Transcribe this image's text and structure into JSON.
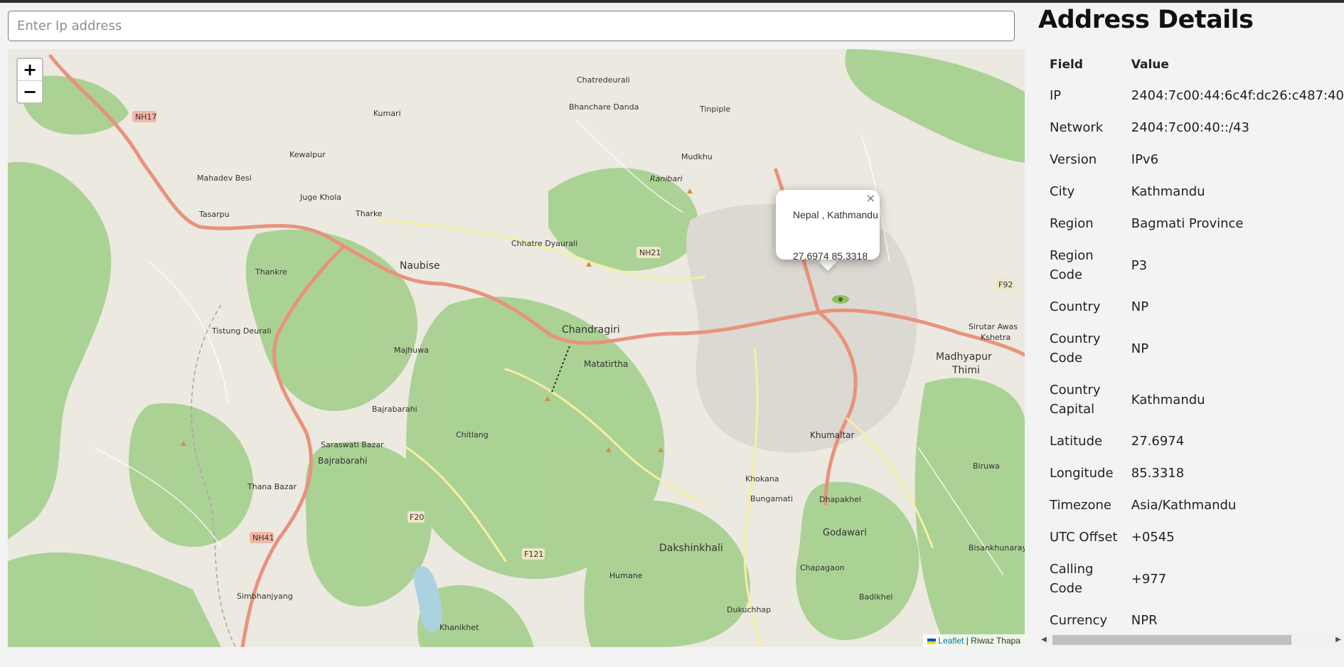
{
  "search": {
    "placeholder": "Enter Ip address"
  },
  "map": {
    "zoom_in": "+",
    "zoom_out": "−",
    "popup": {
      "location": "Nepal , Kathmandu",
      "coords": "27.6974 85.3318",
      "close": "×"
    },
    "attribution": {
      "leaflet": "Leaflet",
      "separator": " | ",
      "author": "Riwaz Thapa"
    },
    "labels": [
      "Chandragiri",
      "Naubise",
      "Dakshinkhali",
      "Khumaltar",
      "Godawari",
      "Matatirtha",
      "Kewalpur",
      "Kumari",
      "Tarke",
      "Thankre",
      "Majhuwa",
      "Chitlang",
      "Bajrabarahi",
      "Saraswati Bazar",
      "Thana Bazar",
      "Simbhanjyang",
      "Tistung Deurali",
      "Mahadev Besi",
      "Juge Khola",
      "Tasarpu",
      "Chhatre Dyaurali",
      "Bhanchare Danda",
      "Chatredeurali",
      "Tinpiple",
      "Mudkhu",
      "Ranibari",
      "Khokana",
      "Bungamati",
      "Dhapakhel",
      "Chapagaon",
      "Humane",
      "Dukuchhap",
      "Khanikhet",
      "Madhyapur Thimi",
      "Sirutar Awas Kshetra",
      "Biruwa",
      "Bisankhunarayan",
      "Badikhel",
      "NH17",
      "NH21",
      "NH41",
      "F20",
      "F121",
      "F92"
    ],
    "colors": {
      "land": "#ece9e1",
      "forest": "#a4cf8d",
      "road_primary": "#e8927c",
      "road_secondary": "#f7f5b3",
      "water": "#aad3df"
    }
  },
  "panel": {
    "title": "Address Details",
    "headers": {
      "field": "Field",
      "value": "Value"
    },
    "rows": [
      {
        "field": "IP",
        "value": "2404:7c00:44:6c4f:dc26:c487:40"
      },
      {
        "field": "Network",
        "value": "2404:7c00:40::/43"
      },
      {
        "field": "Version",
        "value": "IPv6"
      },
      {
        "field": "City",
        "value": "Kathmandu"
      },
      {
        "field": "Region",
        "value": "Bagmati Province"
      },
      {
        "field": "Region Code",
        "value": "P3"
      },
      {
        "field": "Country",
        "value": "NP"
      },
      {
        "field": "Country Code",
        "value": "NP"
      },
      {
        "field": "Country Capital",
        "value": "Kathmandu"
      },
      {
        "field": "Latitude",
        "value": "27.6974"
      },
      {
        "field": "Longitude",
        "value": "85.3318"
      },
      {
        "field": "Timezone",
        "value": "Asia/Kathmandu"
      },
      {
        "field": "UTC Offset",
        "value": "+0545"
      },
      {
        "field": "Calling Code",
        "value": "+977"
      },
      {
        "field": "Currency",
        "value": "NPR"
      }
    ],
    "scroll_left": "◀",
    "scroll_right": "▶"
  }
}
